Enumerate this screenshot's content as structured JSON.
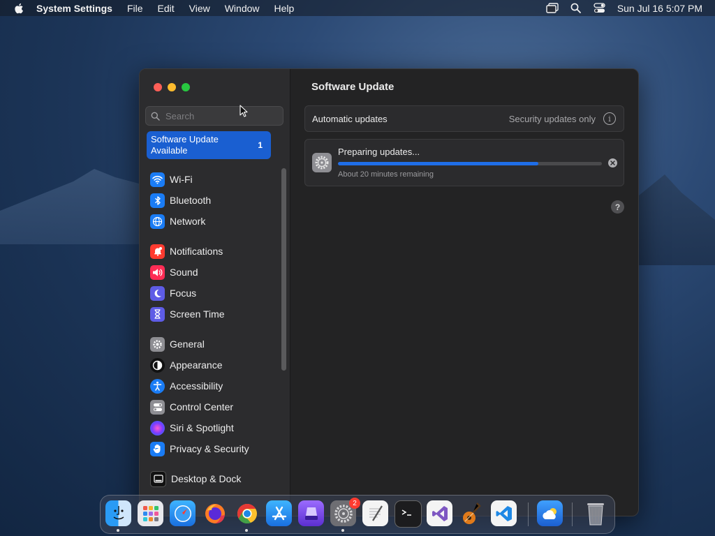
{
  "menubar": {
    "app_name": "System Settings",
    "menus": [
      "File",
      "Edit",
      "View",
      "Window",
      "Help"
    ],
    "clock": "Sun Jul 16  5:07 PM"
  },
  "window": {
    "search": {
      "placeholder": "Search",
      "value": ""
    },
    "update_banner": {
      "label": "Software Update Available",
      "badge": "1"
    },
    "sidebar": {
      "items": [
        {
          "label": "Wi-Fi",
          "icon": "wifi-icon",
          "color": "#1a7cf5"
        },
        {
          "label": "Bluetooth",
          "icon": "bluetooth-icon",
          "color": "#1a7cf5"
        },
        {
          "label": "Network",
          "icon": "globe-icon",
          "color": "#1a7cf5"
        },
        {
          "label": "Notifications",
          "icon": "bell-icon",
          "color": "#ff3b30"
        },
        {
          "label": "Sound",
          "icon": "speaker-icon",
          "color": "#ff2d55"
        },
        {
          "label": "Focus",
          "icon": "moon-icon",
          "color": "#5e5ce6"
        },
        {
          "label": "Screen Time",
          "icon": "hourglass-icon",
          "color": "#5e5ce6"
        },
        {
          "label": "General",
          "icon": "gear-icon",
          "color": "#8e8e93"
        },
        {
          "label": "Appearance",
          "icon": "appearance-icon",
          "color": "#111111"
        },
        {
          "label": "Accessibility",
          "icon": "accessibility-icon",
          "color": "#1a7cf5"
        },
        {
          "label": "Control Center",
          "icon": "toggles-icon",
          "color": "#8e8e93"
        },
        {
          "label": "Siri & Spotlight",
          "icon": "siri-icon",
          "color": "#b93cf6"
        },
        {
          "label": "Privacy & Security",
          "icon": "hand-icon",
          "color": "#1a7cf5"
        },
        {
          "label": "Desktop & Dock",
          "icon": "dock-icon",
          "color": "#111111"
        }
      ]
    },
    "content": {
      "title": "Software Update",
      "automatic_updates": {
        "label": "Automatic updates",
        "value": "Security updates only"
      },
      "progress": {
        "title": "Preparing updates...",
        "subtitle": "About 20 minutes remaining",
        "fraction": 0.76
      }
    }
  },
  "dock": {
    "apps": [
      {
        "name": "Finder",
        "icon": "finder-icon",
        "running": true
      },
      {
        "name": "Launchpad",
        "icon": "launchpad-icon",
        "running": false
      },
      {
        "name": "Safari",
        "icon": "safari-icon",
        "running": false
      },
      {
        "name": "Firefox",
        "icon": "firefox-icon",
        "running": false
      },
      {
        "name": "Chrome",
        "icon": "chrome-icon",
        "running": true
      },
      {
        "name": "App Store",
        "icon": "appstore-icon",
        "running": false
      },
      {
        "name": "Automator",
        "icon": "automator-icon",
        "running": false
      },
      {
        "name": "System Settings",
        "icon": "settings-icon",
        "running": true,
        "badge": "2"
      },
      {
        "name": "TextEdit",
        "icon": "textedit-icon",
        "running": false
      },
      {
        "name": "Terminal",
        "icon": "terminal-icon",
        "running": false
      },
      {
        "name": "Visual Studio",
        "icon": "visualstudio-icon",
        "running": false
      },
      {
        "name": "GarageBand",
        "icon": "garageband-icon",
        "running": false
      },
      {
        "name": "VS Code",
        "icon": "vscode-icon",
        "running": false
      },
      {
        "name": "Weather",
        "icon": "weather-icon",
        "running": false
      },
      {
        "name": "Trash",
        "icon": "trash-icon",
        "running": false
      }
    ]
  }
}
